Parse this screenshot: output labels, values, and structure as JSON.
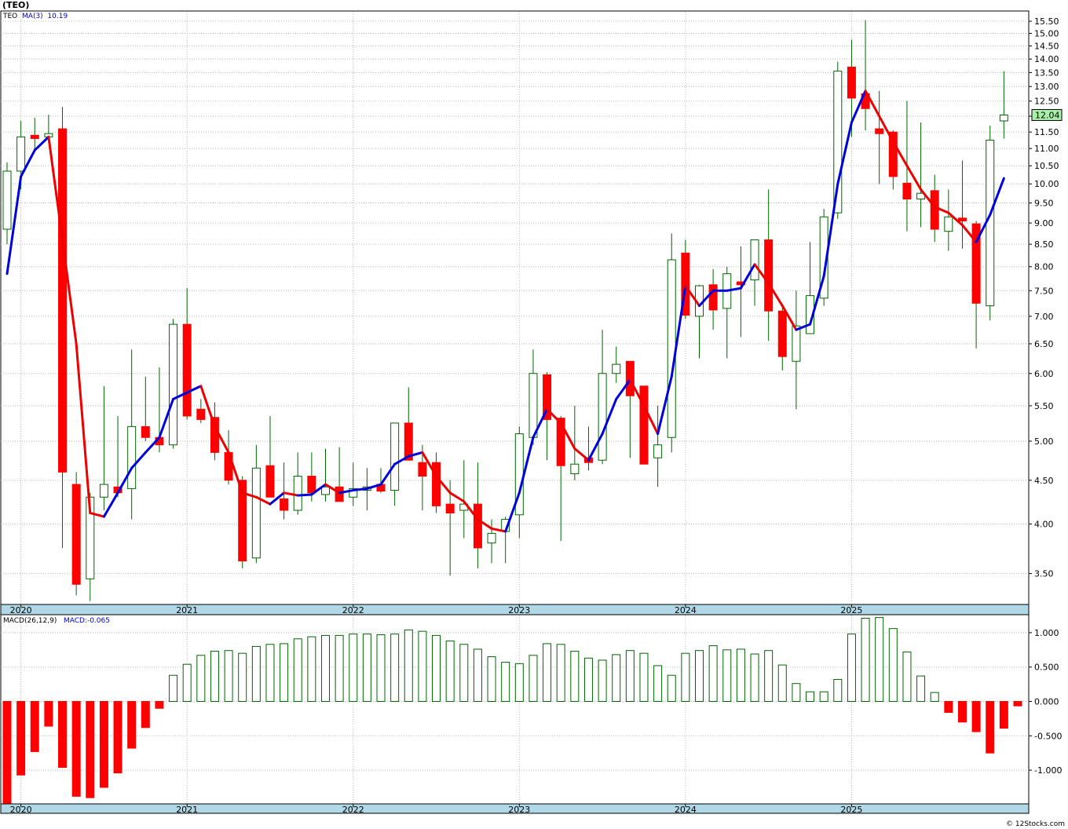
{
  "title": "(TEO)",
  "price_legend": {
    "ticker": "TEO",
    "ma_label": "MA(3)",
    "ma_value": "10.19"
  },
  "macd_legend": {
    "label": "MACD(26,12,9)",
    "value_label": "MACD:-0.065"
  },
  "last_price": "12.04",
  "credit": "© 12Stocks.com",
  "colors": {
    "up_candle": "#ffffff",
    "down_candle": "#ff0000",
    "wick": "#006600",
    "ma_up": "#0000dd",
    "ma_down": "#ee0000",
    "macd_pos_border": "#006600",
    "macd_neg": "#ff0000",
    "axis_band": "#b0d8e6",
    "grid": "#b8b8b8",
    "price_tag": "#a8f0a8"
  },
  "chart_data": [
    {
      "type": "candlestick",
      "frequency": "monthly",
      "y_scale": "log",
      "ylim": [
        3.22,
        15.9
      ],
      "y_ticks": [
        "3.50",
        "4.00",
        "4.50",
        "5.00",
        "5.50",
        "6.00",
        "6.50",
        "7.00",
        "7.50",
        "8.00",
        "8.50",
        "9.00",
        "9.50",
        "10.00",
        "10.50",
        "11.00",
        "11.50",
        "12.00",
        "12.50",
        "13.00",
        "13.50",
        "14.00",
        "14.50",
        "15.00",
        "15.50"
      ],
      "x_labels": [
        "2020",
        "2021",
        "2022",
        "2023",
        "2024",
        "2025"
      ],
      "candles": [
        {
          "date": "2019-12",
          "open": 8.85,
          "high": 10.6,
          "low": 8.5,
          "close": 10.35
        },
        {
          "date": "2020-01",
          "open": 10.35,
          "high": 11.85,
          "low": 9.85,
          "close": 11.35
        },
        {
          "date": "2020-02",
          "open": 11.4,
          "high": 11.95,
          "low": 10.95,
          "close": 11.3
        },
        {
          "date": "2020-03",
          "open": 11.35,
          "high": 12.05,
          "low": 11.15,
          "close": 11.45
        },
        {
          "date": "2020-04",
          "open": 11.6,
          "high": 12.3,
          "low": 3.75,
          "close": 4.6
        },
        {
          "date": "2020-05",
          "open": 4.45,
          "high": 4.6,
          "low": 3.3,
          "close": 3.4
        },
        {
          "date": "2020-06",
          "open": 3.45,
          "high": 4.35,
          "low": 3.25,
          "close": 4.3
        },
        {
          "date": "2020-07",
          "open": 4.3,
          "high": 5.8,
          "low": 4.15,
          "close": 4.45
        },
        {
          "date": "2020-08",
          "open": 4.42,
          "high": 5.35,
          "low": 4.3,
          "close": 4.35
        },
        {
          "date": "2020-09",
          "open": 4.4,
          "high": 6.4,
          "low": 4.05,
          "close": 5.2
        },
        {
          "date": "2020-10",
          "open": 5.2,
          "high": 5.95,
          "low": 5.0,
          "close": 5.05
        },
        {
          "date": "2020-11",
          "open": 5.05,
          "high": 6.1,
          "low": 4.85,
          "close": 4.95
        },
        {
          "date": "2020-12",
          "open": 4.95,
          "high": 6.95,
          "low": 4.9,
          "close": 6.85
        },
        {
          "date": "2021-01",
          "open": 6.85,
          "high": 7.55,
          "low": 5.3,
          "close": 5.35
        },
        {
          "date": "2021-02",
          "open": 5.45,
          "high": 5.6,
          "low": 5.25,
          "close": 5.3
        },
        {
          "date": "2021-03",
          "open": 5.33,
          "high": 5.55,
          "low": 4.75,
          "close": 4.85
        },
        {
          "date": "2021-04",
          "open": 4.85,
          "high": 5.15,
          "low": 4.45,
          "close": 4.5
        },
        {
          "date": "2021-05",
          "open": 4.5,
          "high": 4.55,
          "low": 3.55,
          "close": 3.62
        },
        {
          "date": "2021-06",
          "open": 3.65,
          "high": 4.95,
          "low": 3.6,
          "close": 4.65
        },
        {
          "date": "2021-07",
          "open": 4.68,
          "high": 5.35,
          "low": 4.3,
          "close": 4.3
        },
        {
          "date": "2021-08",
          "open": 4.28,
          "high": 4.72,
          "low": 4.05,
          "close": 4.15
        },
        {
          "date": "2021-09",
          "open": 4.15,
          "high": 4.85,
          "low": 4.1,
          "close": 4.55
        },
        {
          "date": "2021-10",
          "open": 4.55,
          "high": 4.85,
          "low": 4.25,
          "close": 4.35
        },
        {
          "date": "2021-11",
          "open": 4.33,
          "high": 4.9,
          "low": 4.25,
          "close": 4.42
        },
        {
          "date": "2021-12",
          "open": 4.42,
          "high": 4.92,
          "low": 4.25,
          "close": 4.25
        },
        {
          "date": "2022-01",
          "open": 4.3,
          "high": 4.72,
          "low": 4.2,
          "close": 4.4
        },
        {
          "date": "2022-02",
          "open": 4.38,
          "high": 4.65,
          "low": 4.15,
          "close": 4.42
        },
        {
          "date": "2022-03",
          "open": 4.45,
          "high": 4.65,
          "low": 4.35,
          "close": 4.37
        },
        {
          "date": "2022-04",
          "open": 4.38,
          "high": 5.25,
          "low": 4.2,
          "close": 5.25
        },
        {
          "date": "2022-05",
          "open": 5.25,
          "high": 5.78,
          "low": 4.8,
          "close": 4.75
        },
        {
          "date": "2022-06",
          "open": 4.72,
          "high": 4.95,
          "low": 4.15,
          "close": 4.55
        },
        {
          "date": "2022-07",
          "open": 4.72,
          "high": 4.85,
          "low": 4.12,
          "close": 4.2
        },
        {
          "date": "2022-08",
          "open": 4.22,
          "high": 4.5,
          "low": 3.48,
          "close": 4.12
        },
        {
          "date": "2022-09",
          "open": 4.15,
          "high": 4.75,
          "low": 3.85,
          "close": 4.22
        },
        {
          "date": "2022-10",
          "open": 4.22,
          "high": 4.72,
          "low": 3.55,
          "close": 3.75
        },
        {
          "date": "2022-11",
          "open": 3.8,
          "high": 4.05,
          "low": 3.6,
          "close": 3.9
        },
        {
          "date": "2022-12",
          "open": 3.92,
          "high": 4.08,
          "low": 3.6,
          "close": 4.05
        },
        {
          "date": "2023-01",
          "open": 4.1,
          "high": 5.2,
          "low": 3.85,
          "close": 5.1
        },
        {
          "date": "2023-02",
          "open": 5.05,
          "high": 6.4,
          "low": 4.95,
          "close": 6.0
        },
        {
          "date": "2023-03",
          "open": 5.98,
          "high": 6.02,
          "low": 4.75,
          "close": 5.3
        },
        {
          "date": "2023-04",
          "open": 5.32,
          "high": 5.35,
          "low": 3.82,
          "close": 4.68
        },
        {
          "date": "2023-05",
          "open": 4.58,
          "high": 5.5,
          "low": 4.5,
          "close": 4.7
        },
        {
          "date": "2023-06",
          "open": 4.78,
          "high": 5.2,
          "low": 4.62,
          "close": 4.72
        },
        {
          "date": "2023-07",
          "open": 4.75,
          "high": 6.75,
          "low": 4.7,
          "close": 6.0
        },
        {
          "date": "2023-08",
          "open": 6.0,
          "high": 6.45,
          "low": 5.85,
          "close": 6.15
        },
        {
          "date": "2023-09",
          "open": 6.2,
          "high": 6.2,
          "low": 4.78,
          "close": 5.65
        },
        {
          "date": "2023-10",
          "open": 5.8,
          "high": 5.8,
          "low": 4.7,
          "close": 4.7
        },
        {
          "date": "2023-11",
          "open": 4.78,
          "high": 5.5,
          "low": 4.42,
          "close": 4.95
        },
        {
          "date": "2023-12",
          "open": 5.05,
          "high": 8.75,
          "low": 4.85,
          "close": 8.15
        },
        {
          "date": "2024-01",
          "open": 8.3,
          "high": 8.6,
          "low": 6.95,
          "close": 7.02
        },
        {
          "date": "2024-02",
          "open": 7.0,
          "high": 7.62,
          "low": 6.25,
          "close": 7.6
        },
        {
          "date": "2024-03",
          "open": 7.62,
          "high": 7.95,
          "low": 6.75,
          "close": 7.12
        },
        {
          "date": "2024-04",
          "open": 7.15,
          "high": 8.0,
          "low": 6.25,
          "close": 7.85
        },
        {
          "date": "2024-05",
          "open": 7.68,
          "high": 8.45,
          "low": 6.62,
          "close": 7.62
        },
        {
          "date": "2024-06",
          "open": 7.72,
          "high": 8.6,
          "low": 7.2,
          "close": 8.6
        },
        {
          "date": "2024-07",
          "open": 8.6,
          "high": 9.85,
          "low": 6.55,
          "close": 7.1
        },
        {
          "date": "2024-08",
          "open": 7.1,
          "high": 7.2,
          "low": 6.05,
          "close": 6.28
        },
        {
          "date": "2024-09",
          "open": 6.2,
          "high": 7.5,
          "low": 5.45,
          "close": 6.82
        },
        {
          "date": "2024-10",
          "open": 6.68,
          "high": 8.55,
          "low": 6.7,
          "close": 7.4
        },
        {
          "date": "2024-11",
          "open": 7.35,
          "high": 9.35,
          "low": 7.2,
          "close": 9.15
        },
        {
          "date": "2024-12",
          "open": 9.25,
          "high": 13.9,
          "low": 9.1,
          "close": 13.55
        },
        {
          "date": "2025-01",
          "open": 13.7,
          "high": 14.75,
          "low": 11.35,
          "close": 12.6
        },
        {
          "date": "2025-02",
          "open": 12.75,
          "high": 15.55,
          "low": 11.55,
          "close": 12.25
        },
        {
          "date": "2025-03",
          "open": 11.6,
          "high": 12.85,
          "low": 10.0,
          "close": 11.45
        },
        {
          "date": "2025-04",
          "open": 11.5,
          "high": 11.55,
          "low": 9.85,
          "close": 10.2
        },
        {
          "date": "2025-05",
          "open": 10.02,
          "high": 12.5,
          "low": 8.8,
          "close": 9.6
        },
        {
          "date": "2025-06",
          "open": 9.6,
          "high": 11.8,
          "low": 8.9,
          "close": 9.75
        },
        {
          "date": "2025-07",
          "open": 9.82,
          "high": 10.25,
          "low": 8.55,
          "close": 8.85
        },
        {
          "date": "2025-08",
          "open": 8.8,
          "high": 9.85,
          "low": 8.35,
          "close": 9.15
        },
        {
          "date": "2025-09",
          "open": 9.12,
          "high": 10.65,
          "low": 8.4,
          "close": 9.05
        },
        {
          "date": "2025-10",
          "open": 8.98,
          "high": 9.05,
          "low": 6.42,
          "close": 7.25
        },
        {
          "date": "2025-11",
          "open": 7.2,
          "high": 11.7,
          "low": 6.92,
          "close": 11.25
        },
        {
          "date": "2025-12",
          "open": 11.85,
          "high": 13.55,
          "low": 11.3,
          "close": 12.04
        }
      ],
      "ma3": [
        7.85,
        10.2,
        10.95,
        11.35,
        8.6,
        6.5,
        4.12,
        4.08,
        4.35,
        4.65,
        4.85,
        5.05,
        5.6,
        5.7,
        5.8,
        5.2,
        4.85,
        4.35,
        4.3,
        4.22,
        4.35,
        4.32,
        4.33,
        4.45,
        4.35,
        4.38,
        4.4,
        4.45,
        4.7,
        4.8,
        4.85,
        4.55,
        4.35,
        4.25,
        4.05,
        3.95,
        3.92,
        4.35,
        5.05,
        5.45,
        5.25,
        4.9,
        4.75,
        5.1,
        5.6,
        5.9,
        5.5,
        5.1,
        5.95,
        7.6,
        7.2,
        7.5,
        7.5,
        7.55,
        8.05,
        7.65,
        7.2,
        6.75,
        6.85,
        7.8,
        10.0,
        11.8,
        12.85,
        12.0,
        11.2,
        10.5,
        9.85,
        9.4,
        9.25,
        8.95,
        8.55,
        9.2,
        10.15
      ]
    },
    {
      "type": "bar",
      "title": "MACD(26,12,9)",
      "ylim": [
        -1.49,
        1.25
      ],
      "y_ticks": [
        "1.000",
        "0.500",
        "0.000",
        "-0.500",
        "-1.000"
      ],
      "values": [
        -1.48,
        -1.07,
        -0.73,
        -0.36,
        -0.96,
        -1.38,
        -1.4,
        -1.25,
        -1.04,
        -0.68,
        -0.38,
        -0.1,
        0.38,
        0.54,
        0.67,
        0.73,
        0.74,
        0.7,
        0.8,
        0.83,
        0.84,
        0.91,
        0.94,
        0.96,
        0.96,
        0.98,
        0.98,
        0.97,
        0.98,
        1.04,
        1.02,
        0.96,
        0.88,
        0.83,
        0.76,
        0.65,
        0.57,
        0.55,
        0.67,
        0.84,
        0.83,
        0.73,
        0.63,
        0.6,
        0.68,
        0.74,
        0.7,
        0.52,
        0.38,
        0.7,
        0.74,
        0.81,
        0.75,
        0.76,
        0.69,
        0.74,
        0.53,
        0.26,
        0.14,
        0.14,
        0.32,
        0.98,
        1.21,
        1.22,
        1.06,
        0.72,
        0.37,
        0.13,
        -0.16,
        -0.3,
        -0.44,
        -0.75,
        -0.39,
        -0.065
      ]
    }
  ]
}
